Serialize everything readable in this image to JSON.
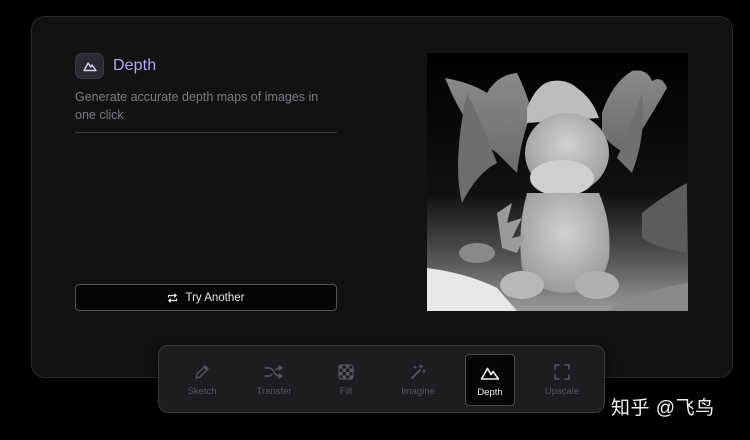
{
  "feature": {
    "icon": "mountain-icon",
    "title": "Depth",
    "description": "Generate accurate depth maps of images in one click"
  },
  "actions": {
    "try_another_label": "Try Another",
    "try_another_icon": "repeat-icon"
  },
  "image": {
    "kind": "depth map of a dragon figurine"
  },
  "toolbar": {
    "tools": [
      {
        "label": "Sketch",
        "icon": "pencil-icon",
        "active": false
      },
      {
        "label": "Transfer",
        "icon": "shuffle-icon",
        "active": false
      },
      {
        "label": "Fill",
        "icon": "checker-icon",
        "active": false
      },
      {
        "label": "Imagine",
        "icon": "magic-wand-icon",
        "active": false
      },
      {
        "label": "Depth",
        "icon": "mountain-icon",
        "active": true
      },
      {
        "label": "Upscale",
        "icon": "expand-icon",
        "active": false
      }
    ]
  },
  "watermark": "知乎 @飞鸟",
  "colors": {
    "accent": "#b6a9f5",
    "card_bg": "#121213",
    "toolbar_bg": "#1d1d20",
    "muted_text": "#7d7d84"
  }
}
